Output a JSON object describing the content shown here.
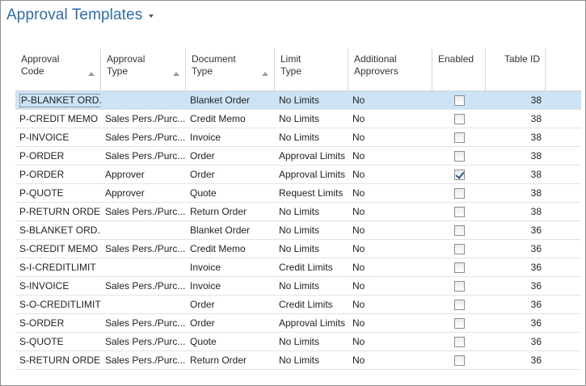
{
  "page": {
    "title": "Approval Templates"
  },
  "columns": [
    {
      "key": "code",
      "label": "Approval\nCode"
    },
    {
      "key": "approval_type",
      "label": "Approval\nType"
    },
    {
      "key": "document_type",
      "label": "Document\nType"
    },
    {
      "key": "limit_type",
      "label": "Limit\nType"
    },
    {
      "key": "additional_approvers",
      "label": "Additional\nApprovers"
    },
    {
      "key": "enabled",
      "label": "Enabled"
    },
    {
      "key": "table_id",
      "label": "Table ID"
    }
  ],
  "rows": [
    {
      "code": "P-BLANKET ORD...",
      "approval_type": "",
      "document_type": "Blanket Order",
      "limit_type": "No Limits",
      "additional_approvers": "No",
      "enabled": false,
      "table_id": "38",
      "selected": true
    },
    {
      "code": "P-CREDIT MEMO",
      "approval_type": "Sales Pers./Purc...",
      "document_type": "Credit Memo",
      "limit_type": "No Limits",
      "additional_approvers": "No",
      "enabled": false,
      "table_id": "38"
    },
    {
      "code": "P-INVOICE",
      "approval_type": "Sales Pers./Purc...",
      "document_type": "Invoice",
      "limit_type": "No Limits",
      "additional_approvers": "No",
      "enabled": false,
      "table_id": "38"
    },
    {
      "code": "P-ORDER",
      "approval_type": "Sales Pers./Purc...",
      "document_type": "Order",
      "limit_type": "Approval Limits",
      "additional_approvers": "No",
      "enabled": false,
      "table_id": "38"
    },
    {
      "code": "P-ORDER",
      "approval_type": "Approver",
      "document_type": "Order",
      "limit_type": "Approval Limits",
      "additional_approvers": "No",
      "enabled": true,
      "table_id": "38"
    },
    {
      "code": "P-QUOTE",
      "approval_type": "Approver",
      "document_type": "Quote",
      "limit_type": "Request Limits",
      "additional_approvers": "No",
      "enabled": false,
      "table_id": "38"
    },
    {
      "code": "P-RETURN ORDER",
      "approval_type": "Sales Pers./Purc...",
      "document_type": "Return Order",
      "limit_type": "No Limits",
      "additional_approvers": "No",
      "enabled": false,
      "table_id": "38"
    },
    {
      "code": "S-BLANKET ORD...",
      "approval_type": "",
      "document_type": "Blanket Order",
      "limit_type": "No Limits",
      "additional_approvers": "No",
      "enabled": false,
      "table_id": "36"
    },
    {
      "code": "S-CREDIT MEMO",
      "approval_type": "Sales Pers./Purc...",
      "document_type": "Credit Memo",
      "limit_type": "No Limits",
      "additional_approvers": "No",
      "enabled": false,
      "table_id": "36"
    },
    {
      "code": "S-I-CREDITLIMIT",
      "approval_type": "",
      "document_type": "Invoice",
      "limit_type": "Credit Limits",
      "additional_approvers": "No",
      "enabled": false,
      "table_id": "36"
    },
    {
      "code": "S-INVOICE",
      "approval_type": "Sales Pers./Purc...",
      "document_type": "Invoice",
      "limit_type": "No Limits",
      "additional_approvers": "No",
      "enabled": false,
      "table_id": "36"
    },
    {
      "code": "S-O-CREDITLIMIT",
      "approval_type": "",
      "document_type": "Order",
      "limit_type": "Credit Limits",
      "additional_approvers": "No",
      "enabled": false,
      "table_id": "36"
    },
    {
      "code": "S-ORDER",
      "approval_type": "Sales Pers./Purc...",
      "document_type": "Order",
      "limit_type": "Approval Limits",
      "additional_approvers": "No",
      "enabled": false,
      "table_id": "36"
    },
    {
      "code": "S-QUOTE",
      "approval_type": "Sales Pers./Purc...",
      "document_type": "Quote",
      "limit_type": "No Limits",
      "additional_approvers": "No",
      "enabled": false,
      "table_id": "36"
    },
    {
      "code": "S-RETURN ORDER",
      "approval_type": "Sales Pers./Purc...",
      "document_type": "Return Order",
      "limit_type": "No Limits",
      "additional_approvers": "No",
      "enabled": false,
      "table_id": "36"
    }
  ]
}
